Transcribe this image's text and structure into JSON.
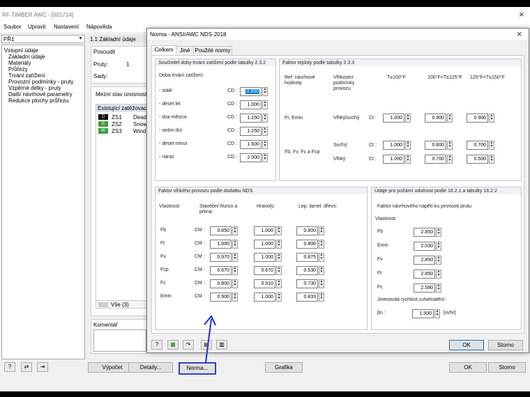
{
  "app": {
    "title": "RF-TIMBER AWC - [001714]",
    "menu": [
      "Soubor",
      "Upravit",
      "Nastavení",
      "Nápověda"
    ]
  },
  "left": {
    "selector": "PŘ1",
    "tree": [
      {
        "label": "Vstupní údaje",
        "indent": 0
      },
      {
        "label": "Základní údaje",
        "indent": 1,
        "selected": true
      },
      {
        "label": "Materiály",
        "indent": 1
      },
      {
        "label": "Průřezy",
        "indent": 1
      },
      {
        "label": "Trvání zatížení",
        "indent": 1
      },
      {
        "label": "Provozní podmínky - pruty",
        "indent": 1
      },
      {
        "label": "Vzpěrné délky - pruty",
        "indent": 1
      },
      {
        "label": "Další návrhové parametry",
        "indent": 1
      },
      {
        "label": "Redukce plochy průřezu",
        "indent": 1
      }
    ]
  },
  "basic": {
    "header": "1.1 Základní údaje",
    "posoudit": "Posoudit",
    "pruty_label": "Pruty:",
    "pruty_value": "1",
    "sady_label": "Sady:",
    "mezni": "Mezní stav únosnosti",
    "exist": "Existující zatěžovací",
    "cases": [
      {
        "tag": "D",
        "color": "#000000",
        "id": "ZS1",
        "desc": "Dead"
      },
      {
        "tag": "S",
        "color": "#4a9a3a",
        "id": "ZS2",
        "desc": "Snow"
      },
      {
        "tag": "W",
        "color": "#3aa04a",
        "id": "ZS3",
        "desc": "Wind"
      }
    ],
    "vse": "Vše (3)",
    "komentar": "Komentář"
  },
  "bottom": {
    "vypocet": "Výpočet",
    "detaily": "Detaily...",
    "norma": "Norma...",
    "grafika": "Grafika",
    "ok": "OK",
    "storno": "Storno"
  },
  "dialog": {
    "title": "Norma - ANSI/AWC NDS-2018",
    "tabs": [
      "Celkem",
      "Jiné",
      "Použité normy"
    ],
    "cd": {
      "title": "Součinitel doby trvání zatížení podle tabulky 2.3.2",
      "sub": "Doba trvání zatížení:",
      "sym": "CD :",
      "rows": [
        {
          "label": "- stálé",
          "value": "0.900"
        },
        {
          "label": "- deset let",
          "value": "1.000"
        },
        {
          "label": "- dva měsíce",
          "value": "1.150"
        },
        {
          "label": "- sedm dní",
          "value": "1.250"
        },
        {
          "label": "- deset minut",
          "value": "1.600"
        },
        {
          "label": "- náraz",
          "value": "2.000"
        }
      ]
    },
    "ct": {
      "title": "Faktor teploty podle tabulky 2.3.3",
      "h1": "Ref. návrhové hodnoty",
      "h2": "Vlhkostní podmínky provozu",
      "h3": "T≤100°F",
      "h4": "100°F<T≤125°F",
      "h5": "125°F<T≤150°F",
      "r1label": "Ft, Emin",
      "r1cond": "Vlhký/suchý",
      "r1sym": "Ct :",
      "r1": [
        "1.000",
        "0.900",
        "0.900"
      ],
      "r2label": "Fb, Fv, Fc a Fcp",
      "r2cond": "Suchý:",
      "r2sym": "Ct :",
      "r2": [
        "1.000",
        "0.800",
        "0.700"
      ],
      "r3cond": "Vlhký:",
      "r3sym": "Ct :",
      "r3": [
        "1.000",
        "0.700",
        "0.500"
      ]
    },
    "cm": {
      "title": "Faktor vlhkého provozu podle dodatku NDS",
      "c1": "Vlastnost:",
      "c2": "Stavební řezivo a prkna:",
      "c3": "Hranoly:",
      "c4": "Lep. lamel. dřevo:",
      "sym": "CM :",
      "rows": [
        {
          "label": "Fb",
          "v": [
            "0.850",
            "1.000",
            "0.800"
          ]
        },
        {
          "label": "Ft",
          "v": [
            "1.000",
            "1.000",
            "0.800"
          ]
        },
        {
          "label": "Fv",
          "v": [
            "0.970",
            "1.000",
            "0.875"
          ]
        },
        {
          "label": "Fcp",
          "v": [
            "0.670",
            "0.670",
            "0.530"
          ]
        },
        {
          "label": "Fc",
          "v": [
            "0.800",
            "0.910",
            "0.730"
          ]
        },
        {
          "label": "Emin",
          "v": [
            "0.900",
            "1.000",
            "0.833"
          ]
        }
      ]
    },
    "fire": {
      "title": "Údaje pro požární odolnost podle 16.2.1 a tabulky 16.2.2",
      "sub": "Faktor návrhového napětí ku pevnosti prutu",
      "vl": "Vlastnost:",
      "rows": [
        {
          "label": "Fb",
          "value": "2.850"
        },
        {
          "label": "Emin",
          "value": "2.030"
        },
        {
          "label": "Fv",
          "value": "2.850"
        },
        {
          "label": "Ft",
          "value": "2.850"
        },
        {
          "label": "Fc",
          "value": "2.580"
        }
      ],
      "char": "Jmenovitá rychlost zuhelnatění:",
      "beta": "βn :",
      "beta_value": "1.500",
      "unit": "[in/hr]"
    },
    "ok": "OK",
    "storno": "Storno"
  },
  "colors": {
    "accent": "#0078d7",
    "annotation": "#2f3fd0"
  }
}
